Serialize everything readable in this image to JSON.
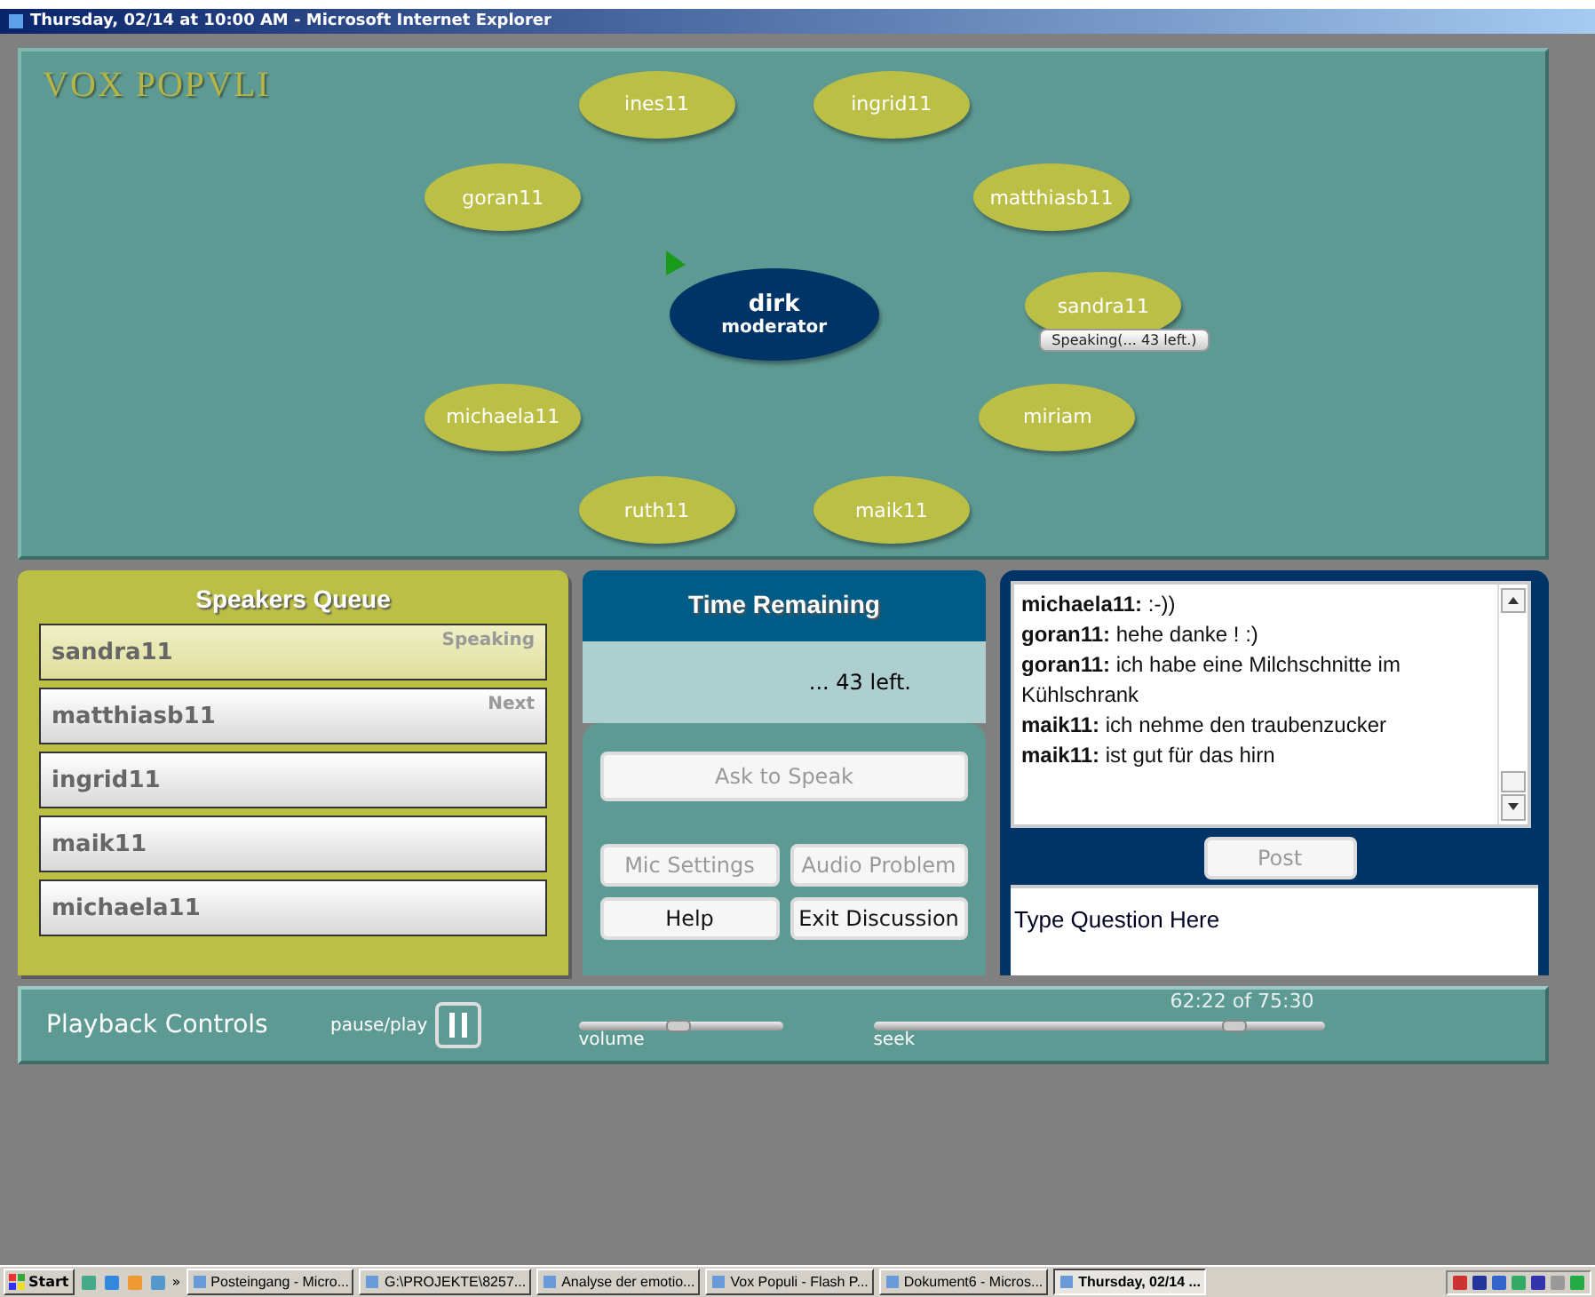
{
  "window": {
    "title": "Thursday, 02/14 at 10:00 AM - Microsoft Internet Explorer"
  },
  "logo": "VOX POPVLI",
  "participants": [
    {
      "name": "ines11",
      "kind": "participant"
    },
    {
      "name": "ingrid11",
      "kind": "participant"
    },
    {
      "name": "goran11",
      "kind": "participant"
    },
    {
      "name": "matthiasb11",
      "kind": "participant"
    },
    {
      "name": "dirk",
      "role": "moderator",
      "kind": "moderator"
    },
    {
      "name": "sandra11",
      "kind": "participant",
      "tag": "Speaking(... 43 left.)"
    },
    {
      "name": "michaela11",
      "kind": "participant"
    },
    {
      "name": "miriam",
      "kind": "participant"
    },
    {
      "name": "ruth11",
      "kind": "participant"
    },
    {
      "name": "maik11",
      "kind": "participant"
    }
  ],
  "queue": {
    "title": "Speakers Queue",
    "items": [
      {
        "name": "sandra11",
        "status": "Speaking",
        "selected": true
      },
      {
        "name": "matthiasb11",
        "status": "Next",
        "selected": false
      },
      {
        "name": "ingrid11",
        "selected": false
      },
      {
        "name": "maik11",
        "selected": false
      },
      {
        "name": "michaela11",
        "selected": false
      }
    ]
  },
  "time": {
    "title": "Time Remaining",
    "value": "... 43 left."
  },
  "controls": [
    {
      "label": "Ask to Speak",
      "disabled": true
    },
    {
      "label": "Mic Settings",
      "disabled": true
    },
    {
      "label": "Audio Problem",
      "disabled": true
    },
    {
      "label": "Help",
      "disabled": false
    },
    {
      "label": "Exit Discussion",
      "disabled": false
    }
  ],
  "chat": {
    "messages": [
      {
        "author": "michaela11:",
        "text": ":-))"
      },
      {
        "author": "goran11:",
        "text": "hehe danke ! :)"
      },
      {
        "author": "goran11:",
        "text": "ich habe eine Milchschnitte im Kühlschrank"
      },
      {
        "author": "maik11:",
        "text": "ich nehme den traubenzucker"
      },
      {
        "author": "maik11:",
        "text": "ist gut für das hirn"
      }
    ],
    "post": {
      "label": "Post",
      "disabled": true
    },
    "input": {
      "value": "Type Question Here"
    }
  },
  "playback": {
    "title": "Playback Controls",
    "pause_label": "pause/play",
    "volume": {
      "label": "volume",
      "level": 0.49
    },
    "seek": {
      "label": "seek",
      "level": 0.8,
      "time": "62:22 of 75:30"
    }
  },
  "taskbar": {
    "start": "Start",
    "more": "»",
    "tasks": [
      {
        "label": "Posteingang - Micro...",
        "selected": false
      },
      {
        "label": "G:\\PROJEKTE\\8257...",
        "selected": false
      },
      {
        "label": "Analyse der emotio...",
        "selected": false
      },
      {
        "label": "Vox Populi - Flash P...",
        "selected": false
      },
      {
        "label": "Dokument6 - Micros...",
        "selected": false
      },
      {
        "label": "Thursday, 02/14 ...",
        "selected": true
      }
    ]
  }
}
